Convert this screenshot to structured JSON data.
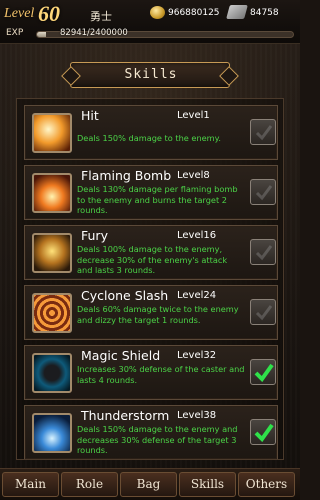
{
  "status": {
    "level_word": "Level",
    "level_value": "60",
    "title": "勇士",
    "gold": "966880125",
    "gems": "84758",
    "exp_label": "EXP",
    "exp_text": "82941/2400000",
    "exp_progress": 0.0346
  },
  "header": {
    "title": "Skills"
  },
  "skills": [
    {
      "name": "Hit",
      "level": "Level1",
      "desc": "Deals 150% damage to the enemy.",
      "icon": "hit-slash-icon",
      "checked": false
    },
    {
      "name": "Flaming Bomb",
      "level": "Level8",
      "desc": "Deals 130% damage per flaming bomb to the enemy and burns the target 2 rounds.",
      "icon": "flaming-bomb-icon",
      "checked": false
    },
    {
      "name": "Fury",
      "level": "Level16",
      "desc": "Deals 100% damage to the enemy, decrease 30% of the enemy's attack and lasts 3 rounds.",
      "icon": "fury-icon",
      "checked": false
    },
    {
      "name": "Cyclone Slash",
      "level": "Level24",
      "desc": "Deals 60% damage twice to the enemy and dizzy the target 1 rounds.",
      "icon": "cyclone-slash-icon",
      "checked": false
    },
    {
      "name": "Magic Shield",
      "level": "Level32",
      "desc": "Increases 30% defense of the caster and lasts 4 rounds.",
      "icon": "magic-shield-icon",
      "checked": true
    },
    {
      "name": "Thunderstorm",
      "level": "Level38",
      "desc": "Deals 150% damage to the enemy and decreases 30% defense of the target 3 rounds.",
      "icon": "thunderstorm-icon",
      "checked": true
    }
  ],
  "tabs": [
    {
      "label": "Main"
    },
    {
      "label": "Role"
    },
    {
      "label": "Bag"
    },
    {
      "label": "Skills"
    },
    {
      "label": "Others"
    }
  ],
  "colors": {
    "desc_text": "#4bd247",
    "level_gold": "#ffd77a",
    "check_on": "#2fe24a",
    "check_off": "#9a9a9a"
  }
}
